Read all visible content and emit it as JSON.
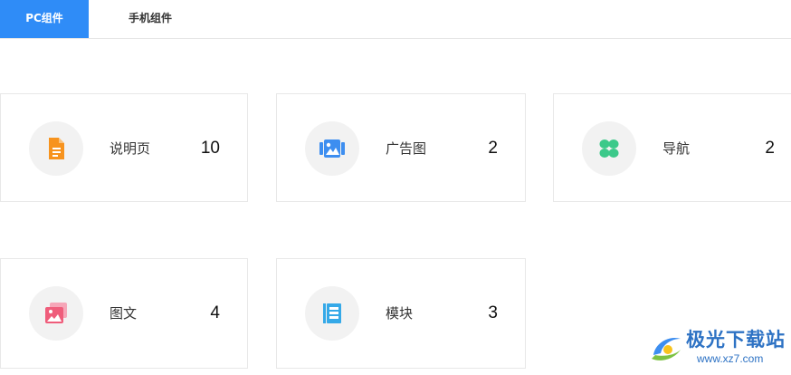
{
  "tabs": [
    {
      "label": "PC组件",
      "active": true
    },
    {
      "label": "手机组件",
      "active": false
    }
  ],
  "cards": [
    {
      "label": "说明页",
      "count": "10",
      "icon": "document-icon",
      "color": "#f7931e"
    },
    {
      "label": "广告图",
      "count": "2",
      "icon": "image-gallery-icon",
      "color": "#3d8ef0"
    },
    {
      "label": "导航",
      "count": "2",
      "icon": "four-dots-icon",
      "color": "#3cc98a"
    },
    {
      "label": "图文",
      "count": "4",
      "icon": "image-stack-icon",
      "color": "#ef5d7b"
    },
    {
      "label": "模块",
      "count": "3",
      "icon": "stacked-pages-icon",
      "color": "#35a9e8"
    }
  ],
  "watermark": {
    "title": "极光下载站",
    "url": "www.xz7.com"
  }
}
